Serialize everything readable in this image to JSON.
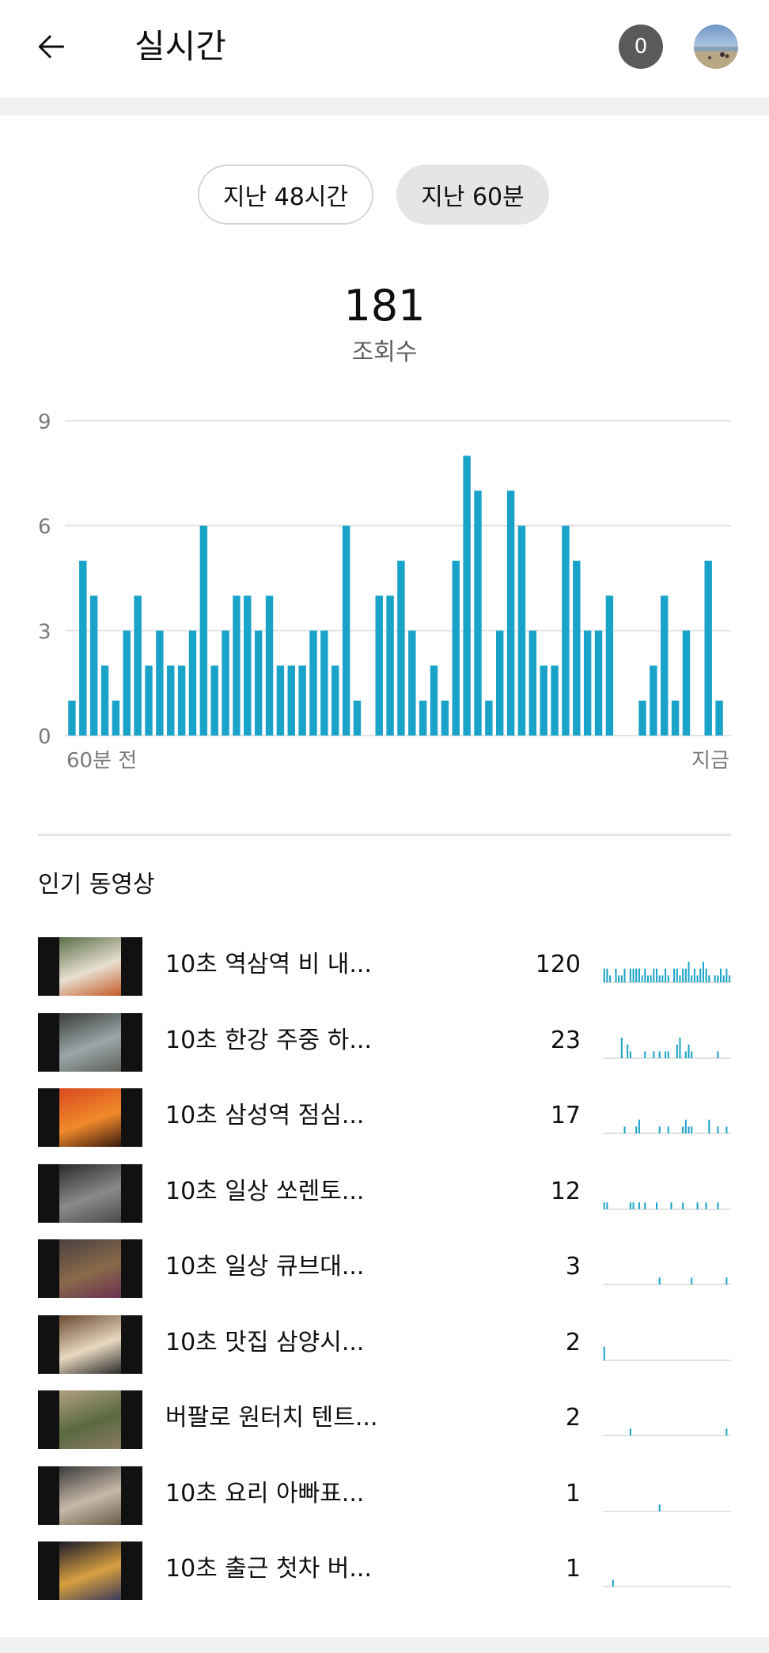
{
  "header": {
    "title": "실시간",
    "notification_count": "0",
    "back_icon": "arrow-left-icon",
    "avatar_icon": "profile-avatar"
  },
  "filters": [
    {
      "label": "지난 48시간",
      "selected": false
    },
    {
      "label": "지난 60분",
      "selected": true
    }
  ],
  "summary": {
    "count": "181",
    "label": "조회수"
  },
  "chart_data": {
    "type": "bar",
    "color": "#1aa3c9",
    "ylim": [
      0,
      9
    ],
    "y_ticks": [
      "0",
      "3",
      "6",
      "9"
    ],
    "x_tick_labels": [
      "60분 전",
      "지금"
    ],
    "grid": true,
    "values": [
      1,
      5,
      4,
      2,
      1,
      3,
      4,
      2,
      3,
      2,
      2,
      3,
      6,
      2,
      3,
      4,
      4,
      3,
      4,
      2,
      2,
      2,
      3,
      3,
      2,
      6,
      1,
      0,
      4,
      4,
      5,
      3,
      1,
      2,
      1,
      5,
      8,
      7,
      1,
      3,
      7,
      6,
      3,
      2,
      2,
      6,
      5,
      3,
      3,
      4,
      0,
      0,
      1,
      2,
      4,
      1,
      3,
      0,
      5,
      1
    ]
  },
  "popular": {
    "title": "인기 동영상",
    "spark_color": "#1aa3c9",
    "videos": [
      {
        "title": "10초 역삼역 비 내...",
        "views": "120",
        "thumb": [
          "#5a6e4a",
          "#e8e0d0",
          "#c45a2a"
        ],
        "spark": [
          2,
          2,
          1,
          0,
          2,
          1,
          1,
          2,
          0,
          2,
          2,
          2,
          2,
          1,
          2,
          1,
          1,
          2,
          2,
          1,
          1,
          2,
          1,
          0,
          2,
          2,
          1,
          2,
          2,
          3,
          1,
          2,
          1,
          2,
          3,
          2,
          1,
          0,
          1,
          1,
          2,
          1,
          2,
          1
        ]
      },
      {
        "title": "10초 한강 주중 하...",
        "views": "23",
        "thumb": [
          "#3a3d3a",
          "#9aa7a8",
          "#5e5f5a"
        ],
        "spark": [
          0,
          0,
          0,
          0,
          0,
          0,
          3,
          0,
          2,
          1,
          0,
          0,
          0,
          0,
          1,
          0,
          0,
          1,
          0,
          1,
          0,
          1,
          1,
          0,
          0,
          2,
          3,
          0,
          1,
          2,
          1,
          0,
          0,
          0,
          0,
          0,
          0,
          0,
          0,
          1,
          0,
          0,
          0,
          0
        ]
      },
      {
        "title": "10초 삼성역 점심...",
        "views": "17",
        "thumb": [
          "#d9491f",
          "#f08a2a",
          "#3a1a10"
        ],
        "spark": [
          0,
          0,
          0,
          0,
          0,
          0,
          0,
          1,
          0,
          0,
          0,
          1,
          2,
          0,
          0,
          0,
          0,
          0,
          0,
          1,
          0,
          0,
          1,
          0,
          0,
          0,
          0,
          1,
          2,
          1,
          1,
          0,
          0,
          0,
          0,
          0,
          2,
          0,
          0,
          1,
          0,
          0,
          1,
          0
        ]
      },
      {
        "title": "10초 일상 쏘렌토...",
        "views": "12",
        "thumb": [
          "#2a2a2a",
          "#8a8a8a",
          "#4a4a4a"
        ],
        "spark": [
          1,
          1,
          0,
          0,
          0,
          0,
          0,
          0,
          0,
          1,
          1,
          0,
          1,
          0,
          1,
          0,
          0,
          0,
          1,
          0,
          0,
          0,
          0,
          1,
          0,
          0,
          0,
          1,
          0,
          0,
          0,
          0,
          1,
          0,
          0,
          1,
          0,
          0,
          0,
          1,
          0,
          0,
          0,
          0
        ]
      },
      {
        "title": "10초 일상 큐브대...",
        "views": "3",
        "thumb": [
          "#4a4040",
          "#8a6a4a",
          "#6a3050"
        ],
        "spark": [
          0,
          0,
          0,
          0,
          0,
          0,
          0,
          0,
          0,
          0,
          0,
          0,
          0,
          0,
          0,
          0,
          0,
          0,
          0,
          1,
          0,
          0,
          0,
          0,
          0,
          0,
          0,
          0,
          0,
          0,
          1,
          0,
          0,
          0,
          0,
          0,
          0,
          0,
          0,
          0,
          0,
          0,
          1,
          0
        ]
      },
      {
        "title": "10초 맛집 삼양시...",
        "views": "2",
        "thumb": [
          "#6a4a30",
          "#e8d8c0",
          "#2a2a2a"
        ],
        "spark": [
          2,
          0,
          0,
          0,
          0,
          0,
          0,
          0,
          0,
          0,
          0,
          0,
          0,
          0,
          0,
          0,
          0,
          0,
          0,
          0,
          0,
          0,
          0,
          0,
          0,
          0,
          0,
          0,
          0,
          0,
          0,
          0,
          0,
          0,
          0,
          0,
          0,
          0,
          0,
          0,
          0,
          0,
          0,
          0
        ]
      },
      {
        "title": "버팔로 원터치 텐트...",
        "views": "2",
        "thumb": [
          "#b0a080",
          "#5a6a40",
          "#8a7a60"
        ],
        "spark": [
          0,
          0,
          0,
          0,
          0,
          0,
          0,
          0,
          0,
          1,
          0,
          0,
          0,
          0,
          0,
          0,
          0,
          0,
          0,
          0,
          0,
          0,
          0,
          0,
          0,
          0,
          0,
          0,
          0,
          0,
          0,
          0,
          0,
          0,
          0,
          0,
          0,
          0,
          0,
          0,
          0,
          0,
          1,
          0
        ]
      },
      {
        "title": "10초 요리 아빠표...",
        "views": "1",
        "thumb": [
          "#3a3a3a",
          "#c8b8a8",
          "#6a5a4a"
        ],
        "spark": [
          0,
          0,
          0,
          0,
          0,
          0,
          0,
          0,
          0,
          0,
          0,
          0,
          0,
          0,
          0,
          0,
          0,
          0,
          0,
          1,
          0,
          0,
          0,
          0,
          0,
          0,
          0,
          0,
          0,
          0,
          0,
          0,
          0,
          0,
          0,
          0,
          0,
          0,
          0,
          0,
          0,
          0,
          0,
          0
        ]
      },
      {
        "title": "10초 출근 첫차 버...",
        "views": "1",
        "thumb": [
          "#1a1a2a",
          "#d8a040",
          "#3a3a5a"
        ],
        "spark": [
          0,
          0,
          0,
          1,
          0,
          0,
          0,
          0,
          0,
          0,
          0,
          0,
          0,
          0,
          0,
          0,
          0,
          0,
          0,
          0,
          0,
          0,
          0,
          0,
          0,
          0,
          0,
          0,
          0,
          0,
          0,
          0,
          0,
          0,
          0,
          0,
          0,
          0,
          0,
          0,
          0,
          0,
          0,
          0
        ]
      }
    ]
  }
}
